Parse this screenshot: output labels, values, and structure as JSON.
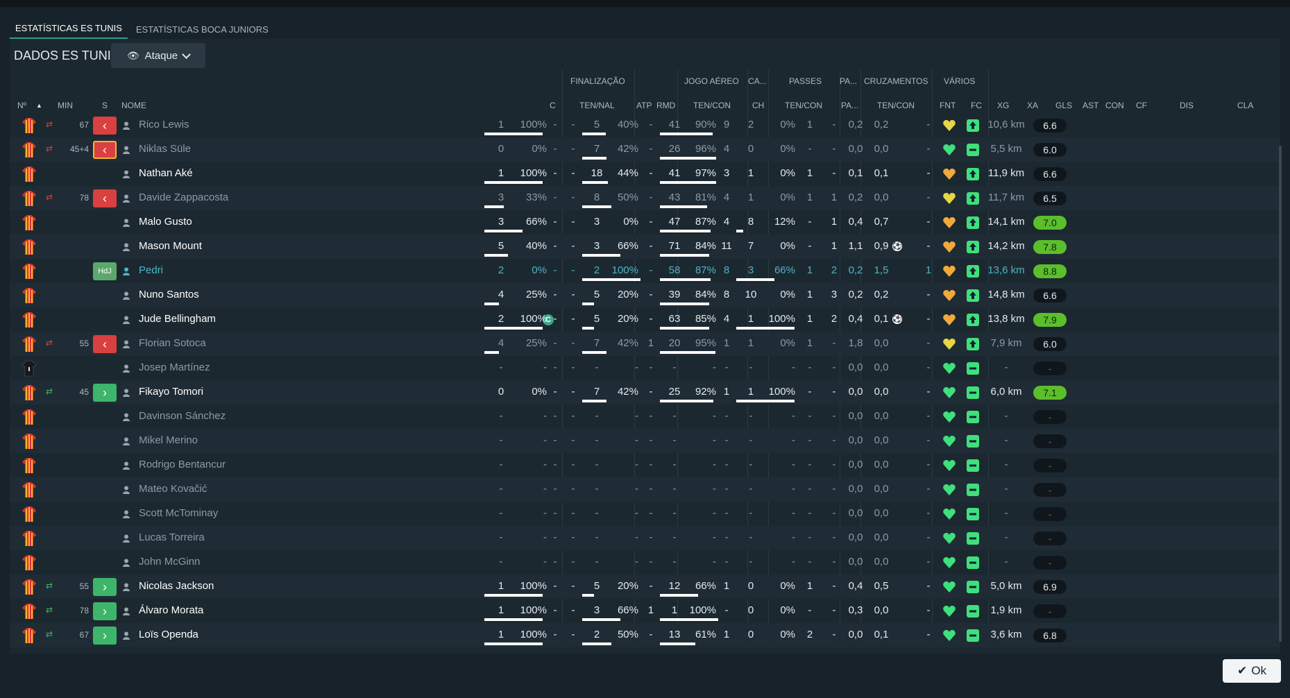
{
  "tabs": [
    {
      "label": "ESTATÍSTICAS ES TUNIS",
      "active": true
    },
    {
      "label": "ESTATÍSTICAS BOCA JUNIORS",
      "active": false
    }
  ],
  "header": {
    "title": "DADOS ES TUNIS",
    "dropdown": "Ataque",
    "dropdown_icon": "eye-icon"
  },
  "groups": [
    {
      "label": "FINALIZAÇÃO"
    },
    {
      "label": "JOGO AÉREO"
    },
    {
      "label": "CA..."
    },
    {
      "label": "PASSES"
    },
    {
      "label": "PA..."
    },
    {
      "label": "CRUZAMENTOS"
    },
    {
      "label": "VÁRIOS"
    }
  ],
  "columns": [
    {
      "label": "Nº"
    },
    {
      "label": "MIN"
    },
    {
      "label": "S"
    },
    {
      "label": "NOME"
    },
    {
      "label": "C"
    },
    {
      "label": "TEN/NAL"
    },
    {
      "label": "ATP"
    },
    {
      "label": "RMD"
    },
    {
      "label": "TEN/CON"
    },
    {
      "label": "CH"
    },
    {
      "label": "TEN/CON"
    },
    {
      "label": "PA..."
    },
    {
      "label": "TEN/CON"
    },
    {
      "label": "FNT"
    },
    {
      "label": "FC"
    },
    {
      "label": "XG"
    },
    {
      "label": "XA"
    },
    {
      "label": "GLS"
    },
    {
      "label": "AST"
    },
    {
      "label": "CON"
    },
    {
      "label": "CF"
    },
    {
      "label": "DIS"
    },
    {
      "label": "CLA"
    }
  ],
  "colors": {
    "accent": "#2f9c8f",
    "sub_out": "#d9403f",
    "sub_in": "#3db56a",
    "highlight": "#4ab6c7",
    "rating_high": "#5bbf2b",
    "con_green": "#3fe07c",
    "con_orange": "#f0a93a",
    "con_yellow": "#e8d646"
  },
  "rows": [
    {
      "name": "Rico Lewis",
      "sub": "out",
      "min": "67",
      "badge": "out",
      "c": "",
      "nal": "1",
      "nalp": "100%",
      "atp": "-",
      "rmd": "-",
      "ae": "5",
      "aep": "40%",
      "ch": "-",
      "pas": "41",
      "pasp": "90%",
      "pa": "9",
      "cz": "2",
      "czp": "0%",
      "fnt": "1",
      "fc": "-",
      "xg": "0,2",
      "xa": "0,2",
      "gls": "",
      "ast": "-",
      "con": "yellow",
      "cf": "up",
      "dis": "10,6 km",
      "cla": "6.6",
      "dim": true
    },
    {
      "name": "Niklas Süle",
      "sub": "out",
      "min": "45+4",
      "badge": "out-outlined",
      "c": "",
      "nal": "0",
      "nalp": "0%",
      "atp": "-",
      "rmd": "-",
      "ae": "7",
      "aep": "42%",
      "ch": "-",
      "pas": "26",
      "pasp": "96%",
      "pa": "4",
      "cz": "0",
      "czp": "0%",
      "fnt": "-",
      "fc": "-",
      "xg": "0,0",
      "xa": "0,0",
      "gls": "",
      "ast": "-",
      "con": "green",
      "cf": "minus",
      "dis": "5,5 km",
      "cla": "6.0",
      "dim": true
    },
    {
      "name": "Nathan Aké",
      "sub": "",
      "min": "",
      "badge": "",
      "c": "",
      "nal": "1",
      "nalp": "100%",
      "atp": "-",
      "rmd": "-",
      "ae": "18",
      "aep": "44%",
      "ch": "-",
      "pas": "41",
      "pasp": "97%",
      "pa": "3",
      "cz": "1",
      "czp": "0%",
      "fnt": "1",
      "fc": "-",
      "xg": "0,1",
      "xa": "0,1",
      "gls": "",
      "ast": "-",
      "con": "orange",
      "cf": "up",
      "dis": "11,9 km",
      "cla": "6.6",
      "dim": false
    },
    {
      "name": "Davide Zappacosta",
      "sub": "out",
      "min": "78",
      "badge": "out",
      "c": "",
      "nal": "3",
      "nalp": "33%",
      "atp": "-",
      "rmd": "-",
      "ae": "8",
      "aep": "50%",
      "ch": "-",
      "pas": "43",
      "pasp": "81%",
      "pa": "4",
      "cz": "1",
      "czp": "0%",
      "fnt": "1",
      "fc": "1",
      "xg": "0,2",
      "xa": "0,0",
      "gls": "",
      "ast": "-",
      "con": "yellow",
      "cf": "up",
      "dis": "11,7 km",
      "cla": "6.5",
      "dim": true
    },
    {
      "name": "Malo Gusto",
      "sub": "",
      "min": "",
      "badge": "",
      "c": "",
      "nal": "3",
      "nalp": "66%",
      "atp": "-",
      "rmd": "-",
      "ae": "3",
      "aep": "0%",
      "ch": "-",
      "pas": "47",
      "pasp": "87%",
      "pa": "4",
      "cz": "8",
      "czp": "12%",
      "fnt": "-",
      "fc": "1",
      "xg": "0,4",
      "xa": "0,7",
      "gls": "",
      "ast": "-",
      "con": "orange",
      "cf": "up",
      "dis": "14,1 km",
      "cla": "7.0",
      "dim": false
    },
    {
      "name": "Mason Mount",
      "sub": "",
      "min": "",
      "badge": "",
      "c": "",
      "nal": "5",
      "nalp": "40%",
      "atp": "-",
      "rmd": "-",
      "ae": "3",
      "aep": "66%",
      "ch": "-",
      "pas": "71",
      "pasp": "84%",
      "pa": "11",
      "cz": "7",
      "czp": "0%",
      "fnt": "-",
      "fc": "1",
      "xg": "1,1",
      "xa": "0,9",
      "gls": "ball",
      "ast": "-",
      "con": "orange",
      "cf": "up",
      "dis": "14,2 km",
      "cla": "7.8",
      "dim": false
    },
    {
      "name": "Pedri",
      "sub": "",
      "min": "",
      "badge": "hdj",
      "c": "",
      "nal": "2",
      "nalp": "0%",
      "atp": "-",
      "rmd": "-",
      "ae": "2",
      "aep": "100%",
      "ch": "-",
      "pas": "58",
      "pasp": "87%",
      "pa": "8",
      "cz": "3",
      "czp": "66%",
      "fnt": "1",
      "fc": "2",
      "xg": "0,2",
      "xa": "1,5",
      "gls": "",
      "ast": "1",
      "con": "orange",
      "cf": "up",
      "dis": "13,6 km",
      "cla": "8.8",
      "dim": false,
      "hl": true
    },
    {
      "name": "Nuno Santos",
      "sub": "",
      "min": "",
      "badge": "",
      "c": "",
      "nal": "4",
      "nalp": "25%",
      "atp": "-",
      "rmd": "-",
      "ae": "5",
      "aep": "20%",
      "ch": "-",
      "pas": "39",
      "pasp": "84%",
      "pa": "8",
      "cz": "10",
      "czp": "0%",
      "fnt": "1",
      "fc": "3",
      "xg": "0,2",
      "xa": "0,2",
      "gls": "",
      "ast": "-",
      "con": "orange",
      "cf": "up",
      "dis": "14,8 km",
      "cla": "6.6",
      "dim": false
    },
    {
      "name": "Jude Bellingham",
      "sub": "",
      "min": "",
      "badge": "",
      "c": "C",
      "nal": "2",
      "nalp": "100%",
      "atp": "-",
      "rmd": "-",
      "ae": "5",
      "aep": "20%",
      "ch": "-",
      "pas": "63",
      "pasp": "85%",
      "pa": "4",
      "cz": "1",
      "czp": "100%",
      "fnt": "1",
      "fc": "2",
      "xg": "0,4",
      "xa": "0,1",
      "gls": "ball",
      "ast": "-",
      "con": "orange",
      "cf": "up",
      "dis": "13,8 km",
      "cla": "7.9",
      "dim": false
    },
    {
      "name": "Florian Sotoca",
      "sub": "out",
      "min": "55",
      "badge": "out",
      "c": "",
      "nal": "4",
      "nalp": "25%",
      "atp": "-",
      "rmd": "-",
      "ae": "7",
      "aep": "42%",
      "ch": "1",
      "pas": "20",
      "pasp": "95%",
      "pa": "1",
      "cz": "1",
      "czp": "0%",
      "fnt": "1",
      "fc": "-",
      "xg": "1,8",
      "xa": "0,0",
      "gls": "",
      "ast": "-",
      "con": "yellow",
      "cf": "up",
      "dis": "7,9 km",
      "cla": "6.0",
      "dim": true
    },
    {
      "name": "Josep Martínez",
      "sub": "",
      "min": "",
      "badge": "",
      "c": "",
      "nal": "-",
      "nalp": "-",
      "atp": "-",
      "rmd": "-",
      "ae": "-",
      "aep": "-",
      "ch": "-",
      "pas": "-",
      "pasp": "-",
      "pa": "-",
      "cz": "-",
      "czp": "-",
      "fnt": "-",
      "fc": "-",
      "xg": "0,0",
      "xa": "0,0",
      "gls": "",
      "ast": "-",
      "con": "green",
      "cf": "minus",
      "dis": "-",
      "cla": "-",
      "dim": true,
      "gk": true
    },
    {
      "name": "Fikayo Tomori",
      "sub": "in",
      "min": "45",
      "badge": "in",
      "c": "",
      "nal": "0",
      "nalp": "0%",
      "atp": "-",
      "rmd": "-",
      "ae": "7",
      "aep": "42%",
      "ch": "-",
      "pas": "25",
      "pasp": "92%",
      "pa": "1",
      "cz": "1",
      "czp": "100%",
      "fnt": "-",
      "fc": "-",
      "xg": "0,0",
      "xa": "0,0",
      "gls": "",
      "ast": "-",
      "con": "green",
      "cf": "minus",
      "dis": "6,0 km",
      "cla": "7.1",
      "dim": false
    },
    {
      "name": "Davinson Sánchez",
      "sub": "",
      "min": "",
      "badge": "",
      "c": "",
      "nal": "-",
      "nalp": "-",
      "atp": "-",
      "rmd": "-",
      "ae": "-",
      "aep": "-",
      "ch": "-",
      "pas": "-",
      "pasp": "-",
      "pa": "-",
      "cz": "-",
      "czp": "-",
      "fnt": "-",
      "fc": "-",
      "xg": "0,0",
      "xa": "0,0",
      "gls": "",
      "ast": "-",
      "con": "green",
      "cf": "minus",
      "dis": "-",
      "cla": "-",
      "dim": true
    },
    {
      "name": "Mikel Merino",
      "sub": "",
      "min": "",
      "badge": "",
      "c": "",
      "nal": "-",
      "nalp": "-",
      "atp": "-",
      "rmd": "-",
      "ae": "-",
      "aep": "-",
      "ch": "-",
      "pas": "-",
      "pasp": "-",
      "pa": "-",
      "cz": "-",
      "czp": "-",
      "fnt": "-",
      "fc": "-",
      "xg": "0,0",
      "xa": "0,0",
      "gls": "",
      "ast": "-",
      "con": "green",
      "cf": "minus",
      "dis": "-",
      "cla": "-",
      "dim": true
    },
    {
      "name": "Rodrigo Bentancur",
      "sub": "",
      "min": "",
      "badge": "",
      "c": "",
      "nal": "-",
      "nalp": "-",
      "atp": "-",
      "rmd": "-",
      "ae": "-",
      "aep": "-",
      "ch": "-",
      "pas": "-",
      "pasp": "-",
      "pa": "-",
      "cz": "-",
      "czp": "-",
      "fnt": "-",
      "fc": "-",
      "xg": "0,0",
      "xa": "0,0",
      "gls": "",
      "ast": "-",
      "con": "green",
      "cf": "minus",
      "dis": "-",
      "cla": "-",
      "dim": true
    },
    {
      "name": "Mateo Kovačić",
      "sub": "",
      "min": "",
      "badge": "",
      "c": "",
      "nal": "-",
      "nalp": "-",
      "atp": "-",
      "rmd": "-",
      "ae": "-",
      "aep": "-",
      "ch": "-",
      "pas": "-",
      "pasp": "-",
      "pa": "-",
      "cz": "-",
      "czp": "-",
      "fnt": "-",
      "fc": "-",
      "xg": "0,0",
      "xa": "0,0",
      "gls": "",
      "ast": "-",
      "con": "green",
      "cf": "minus",
      "dis": "-",
      "cla": "-",
      "dim": true
    },
    {
      "name": "Scott McTominay",
      "sub": "",
      "min": "",
      "badge": "",
      "c": "",
      "nal": "-",
      "nalp": "-",
      "atp": "-",
      "rmd": "-",
      "ae": "-",
      "aep": "-",
      "ch": "-",
      "pas": "-",
      "pasp": "-",
      "pa": "-",
      "cz": "-",
      "czp": "-",
      "fnt": "-",
      "fc": "-",
      "xg": "0,0",
      "xa": "0,0",
      "gls": "",
      "ast": "-",
      "con": "green",
      "cf": "minus",
      "dis": "-",
      "cla": "-",
      "dim": true
    },
    {
      "name": "Lucas Torreira",
      "sub": "",
      "min": "",
      "badge": "",
      "c": "",
      "nal": "-",
      "nalp": "-",
      "atp": "-",
      "rmd": "-",
      "ae": "-",
      "aep": "-",
      "ch": "-",
      "pas": "-",
      "pasp": "-",
      "pa": "-",
      "cz": "-",
      "czp": "-",
      "fnt": "-",
      "fc": "-",
      "xg": "0,0",
      "xa": "0,0",
      "gls": "",
      "ast": "-",
      "con": "green",
      "cf": "minus",
      "dis": "-",
      "cla": "-",
      "dim": true
    },
    {
      "name": "John McGinn",
      "sub": "",
      "min": "",
      "badge": "",
      "c": "",
      "nal": "-",
      "nalp": "-",
      "atp": "-",
      "rmd": "-",
      "ae": "-",
      "aep": "-",
      "ch": "-",
      "pas": "-",
      "pasp": "-",
      "pa": "-",
      "cz": "-",
      "czp": "-",
      "fnt": "-",
      "fc": "-",
      "xg": "0,0",
      "xa": "0,0",
      "gls": "",
      "ast": "-",
      "con": "green",
      "cf": "minus",
      "dis": "-",
      "cla": "-",
      "dim": true
    },
    {
      "name": "Nicolas Jackson",
      "sub": "in",
      "min": "55",
      "badge": "in",
      "c": "",
      "nal": "1",
      "nalp": "100%",
      "atp": "-",
      "rmd": "-",
      "ae": "5",
      "aep": "20%",
      "ch": "-",
      "pas": "12",
      "pasp": "66%",
      "pa": "1",
      "cz": "0",
      "czp": "0%",
      "fnt": "1",
      "fc": "-",
      "xg": "0,4",
      "xa": "0,5",
      "gls": "",
      "ast": "-",
      "con": "green",
      "cf": "minus",
      "dis": "5,0 km",
      "cla": "6.9",
      "dim": false
    },
    {
      "name": "Álvaro Morata",
      "sub": "in",
      "min": "78",
      "badge": "in",
      "c": "",
      "nal": "1",
      "nalp": "100%",
      "atp": "-",
      "rmd": "-",
      "ae": "3",
      "aep": "66%",
      "ch": "1",
      "pas": "1",
      "pasp": "100%",
      "pa": "-",
      "cz": "0",
      "czp": "0%",
      "fnt": "-",
      "fc": "-",
      "xg": "0,3",
      "xa": "0,0",
      "gls": "",
      "ast": "-",
      "con": "green",
      "cf": "minus",
      "dis": "1,9 km",
      "cla": "-",
      "dim": false
    },
    {
      "name": "Loïs Openda",
      "sub": "in",
      "min": "67",
      "badge": "in",
      "c": "",
      "nal": "1",
      "nalp": "100%",
      "atp": "-",
      "rmd": "-",
      "ae": "2",
      "aep": "50%",
      "ch": "-",
      "pas": "13",
      "pasp": "61%",
      "pa": "1",
      "cz": "0",
      "czp": "0%",
      "fnt": "2",
      "fc": "-",
      "xg": "0,0",
      "xa": "0,1",
      "gls": "",
      "ast": "-",
      "con": "green",
      "cf": "minus",
      "dis": "3,6 km",
      "cla": "6.8",
      "dim": false
    }
  ],
  "ok_label": "Ok"
}
